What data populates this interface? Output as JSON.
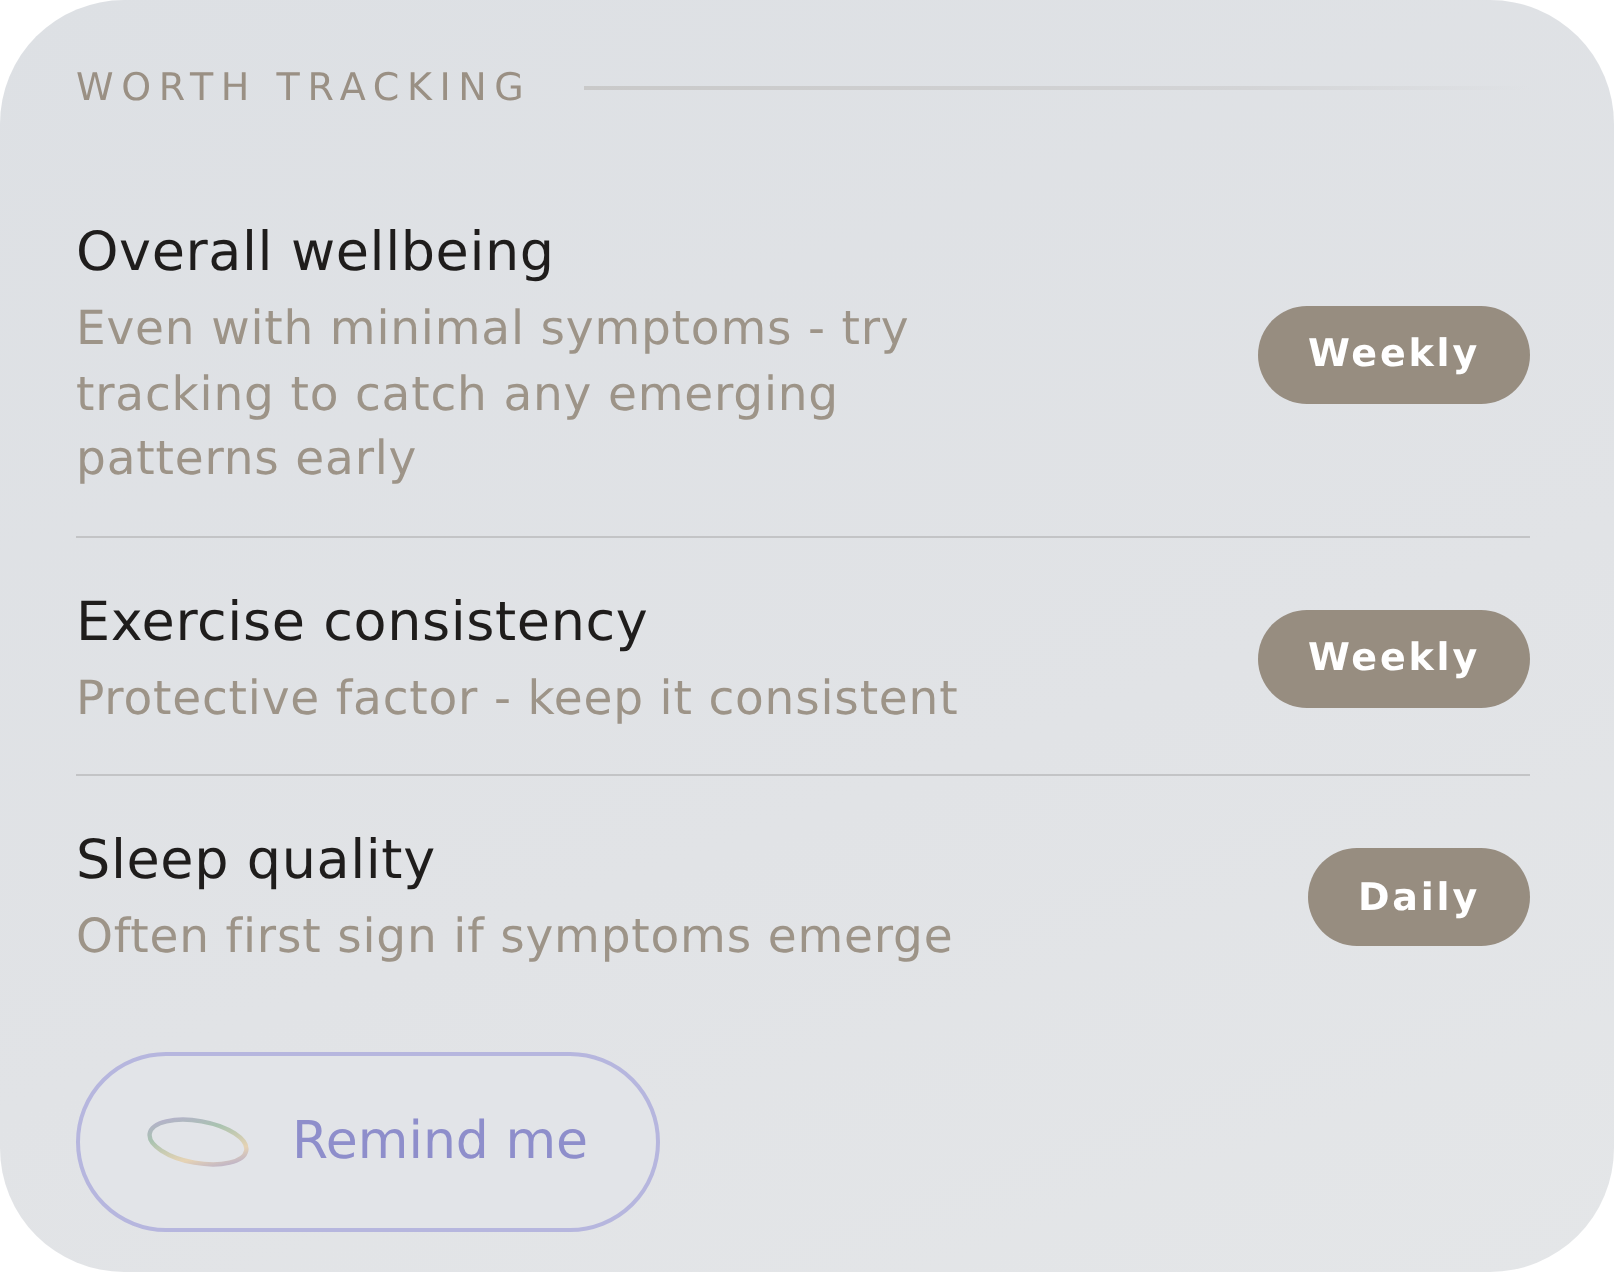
{
  "section": {
    "title": "WORTH TRACKING"
  },
  "items": [
    {
      "title": "Overall wellbeing",
      "description": "Even with minimal symptoms - try tracking to catch any emerging patterns early",
      "frequency": "Weekly"
    },
    {
      "title": "Exercise consistency",
      "description": "Protective factor - keep it consistent",
      "frequency": "Weekly"
    },
    {
      "title": "Sleep quality",
      "description": "Often first sign if symptoms emerge",
      "frequency": "Daily"
    }
  ],
  "button": {
    "label": "Remind me"
  }
}
